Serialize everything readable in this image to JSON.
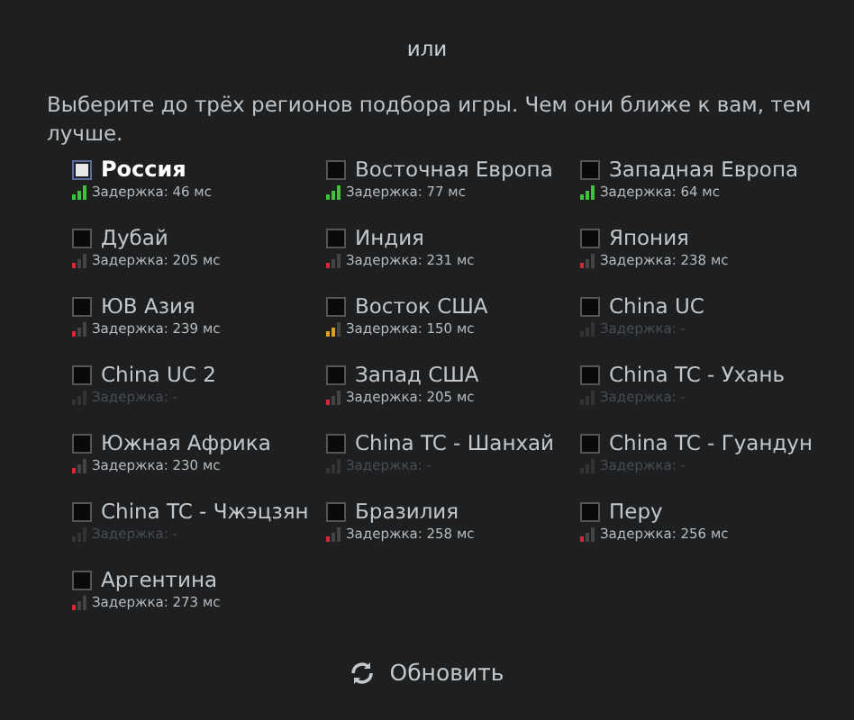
{
  "separator": "или",
  "instruction": "Выберите до трёх регионов подбора игры. Чем они ближе к вам, тем лучше.",
  "regions": [
    {
      "name": "Россия",
      "latency": "Задержка: 46 мс",
      "kind": "good",
      "checked": true
    },
    {
      "name": "Восточная Европа",
      "latency": "Задержка: 77 мс",
      "kind": "good",
      "checked": false
    },
    {
      "name": "Западная Европа",
      "latency": "Задержка: 64 мс",
      "kind": "good",
      "checked": false
    },
    {
      "name": "Дубай",
      "latency": "Задержка: 205 мс",
      "kind": "poor",
      "checked": false
    },
    {
      "name": "Индия",
      "latency": "Задержка: 231 мс",
      "kind": "poor",
      "checked": false
    },
    {
      "name": "Япония",
      "latency": "Задержка: 238 мс",
      "kind": "poor",
      "checked": false
    },
    {
      "name": "ЮВ Азия",
      "latency": "Задержка: 239 мс",
      "kind": "poor",
      "checked": false
    },
    {
      "name": "Восток США",
      "latency": "Задержка: 150 мс",
      "kind": "medium",
      "checked": false
    },
    {
      "name": "China UC",
      "latency": "Задержка: -",
      "kind": "none",
      "checked": false
    },
    {
      "name": "China UC 2",
      "latency": "Задержка: -",
      "kind": "none",
      "checked": false
    },
    {
      "name": "Запад США",
      "latency": "Задержка: 205 мс",
      "kind": "poor",
      "checked": false
    },
    {
      "name": "China TC - Ухань",
      "latency": "Задержка: -",
      "kind": "none",
      "checked": false
    },
    {
      "name": "Южная Африка",
      "latency": "Задержка: 230 мс",
      "kind": "poor",
      "checked": false
    },
    {
      "name": "China TC - Шанхай",
      "latency": "Задержка: -",
      "kind": "none",
      "checked": false
    },
    {
      "name": "China TC - Гуандун",
      "latency": "Задержка: -",
      "kind": "none",
      "checked": false
    },
    {
      "name": "China TC - Чжэцзян",
      "latency": "Задержка: -",
      "kind": "none",
      "checked": false
    },
    {
      "name": "Бразилия",
      "latency": "Задержка: 258 мс",
      "kind": "poor",
      "checked": false
    },
    {
      "name": "Перу",
      "latency": "Задержка: 256 мс",
      "kind": "poor",
      "checked": false
    },
    {
      "name": "Аргентина",
      "latency": "Задержка: 273 мс",
      "kind": "poor",
      "checked": false
    }
  ],
  "refresh_button": "Обновить"
}
